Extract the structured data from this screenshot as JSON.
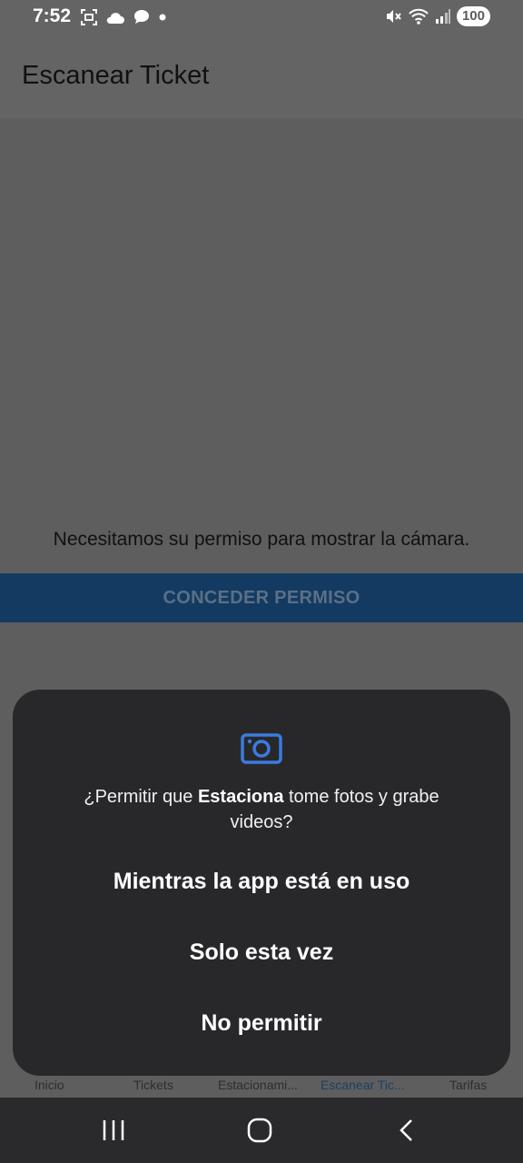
{
  "status_bar": {
    "time": "7:52",
    "battery": "100",
    "left_icons": [
      "screenshot-icon",
      "cloud-icon",
      "chat-bubble-icon",
      "notification-dot-icon"
    ],
    "right_icons": [
      "mute-icon",
      "wifi-icon",
      "signal-icon"
    ]
  },
  "header": {
    "title": "Escanear Ticket"
  },
  "main": {
    "permission_message": "Necesitamos su permiso para mostrar la cámara.",
    "grant_button": "CONCEDER PERMISO"
  },
  "tabs": [
    {
      "label": "Inicio",
      "active": false
    },
    {
      "label": "Tickets",
      "active": false
    },
    {
      "label": "Estacionami...",
      "active": false
    },
    {
      "label": "Escanear Tic...",
      "active": true
    },
    {
      "label": "Tarifas",
      "active": false
    }
  ],
  "dialog": {
    "icon": "camera-icon",
    "message_prefix": "¿Permitir que ",
    "app_name": "Estaciona",
    "message_suffix": " tome fotos y grabe videos?",
    "options": [
      "Mientras la app está en uso",
      "Solo esta vez",
      "No permitir"
    ]
  },
  "colors": {
    "accent": "#3b7be0",
    "dialog_background": "#28282b",
    "grant_button_background": "#133b62"
  }
}
